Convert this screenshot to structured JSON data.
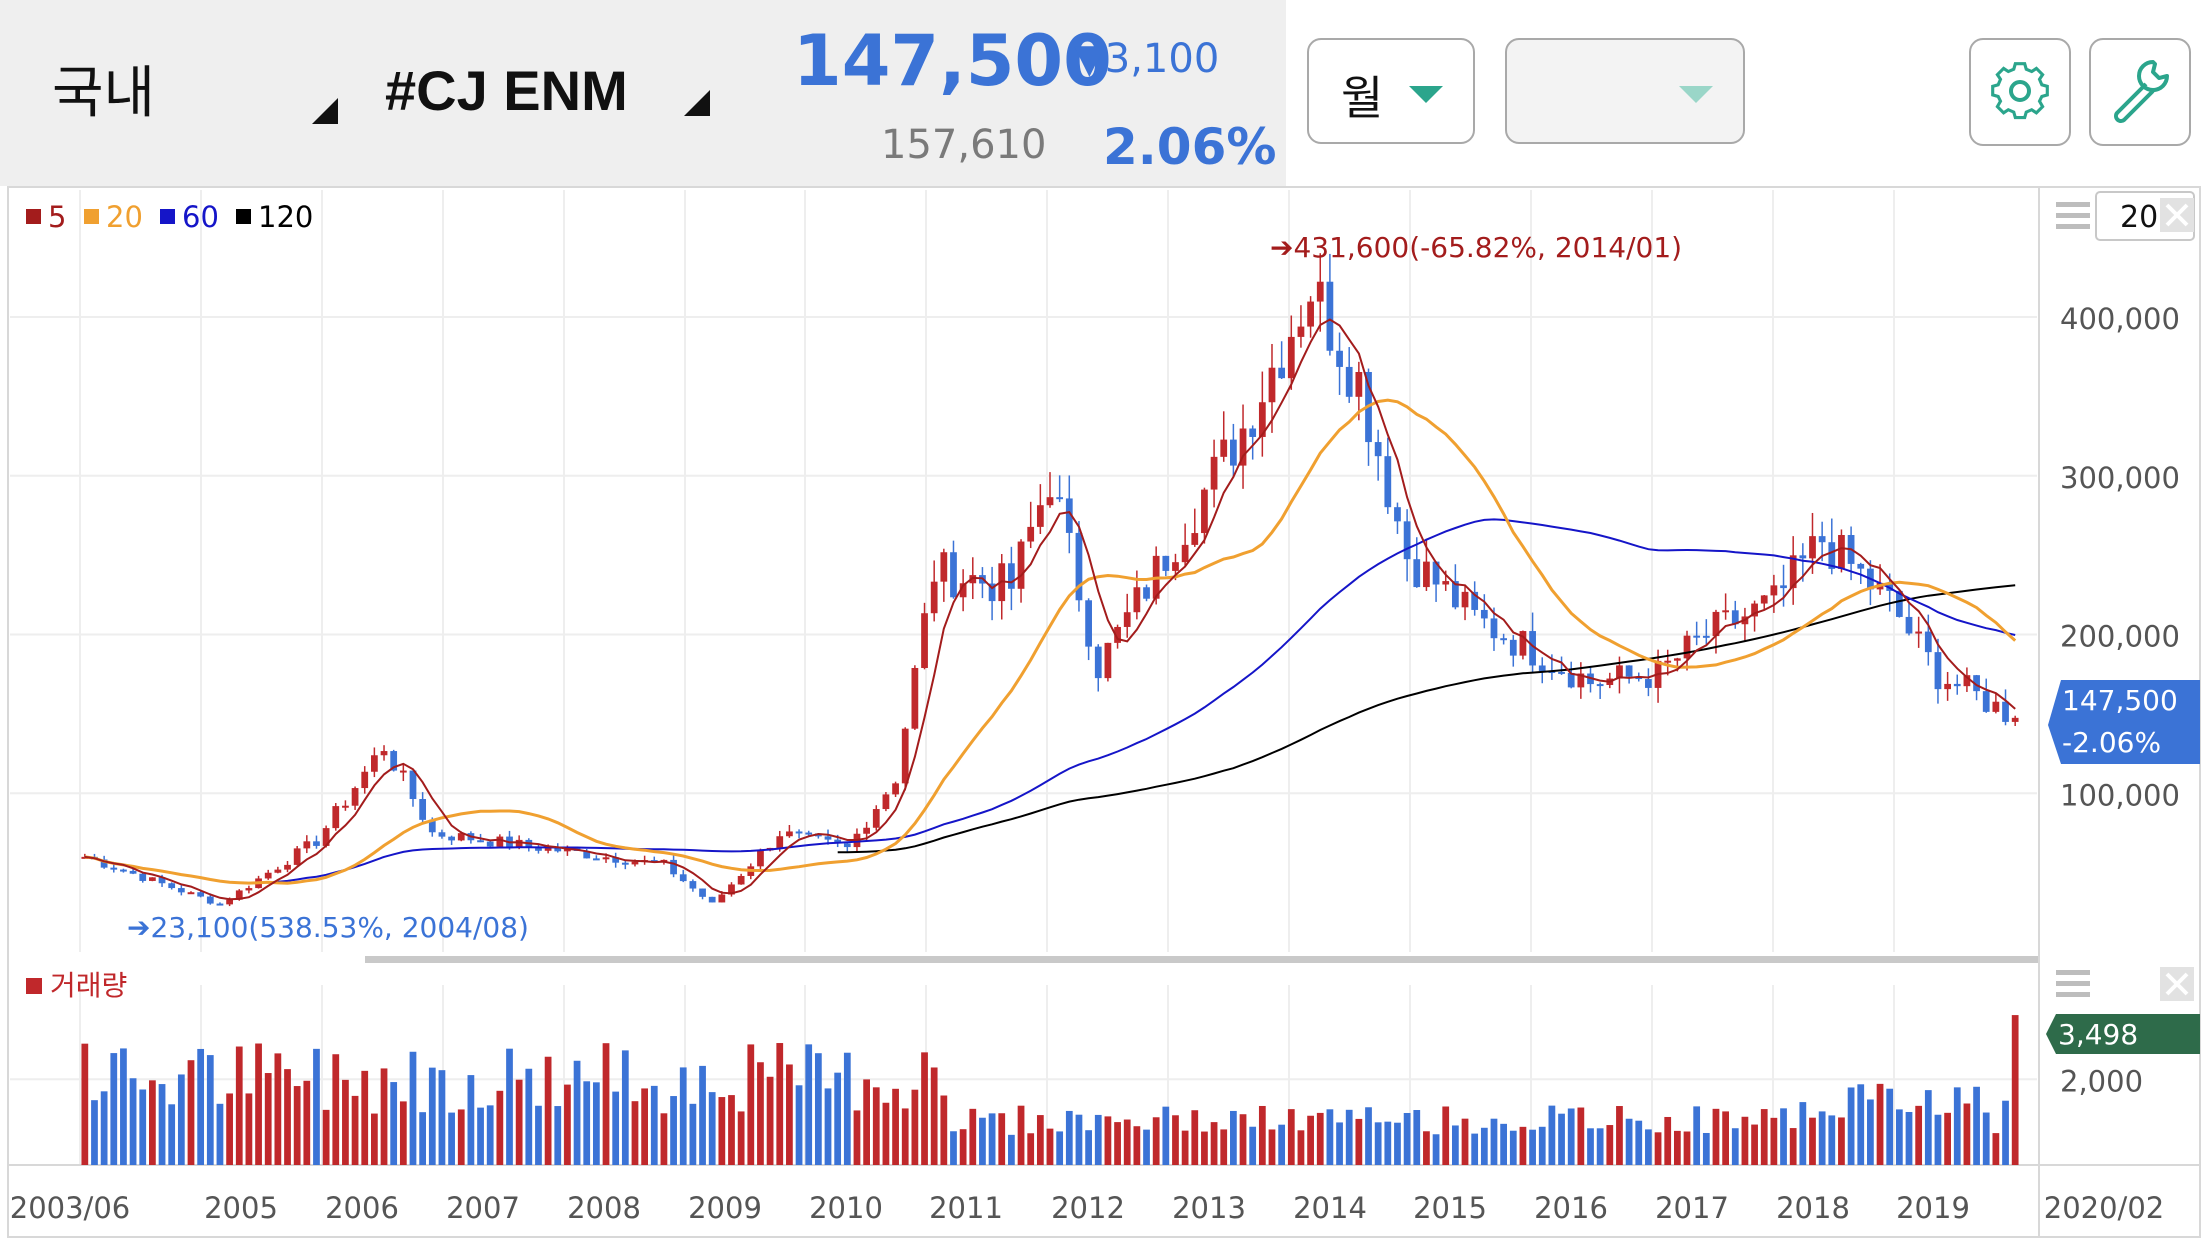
{
  "header": {
    "market": "국내",
    "stock": "#CJ ENM",
    "price": "147,500",
    "change": "▼3,100",
    "prev_value": "157,610",
    "change_pct": "2.06%",
    "period_select": "월",
    "second_select": ""
  },
  "icons": {
    "settings": "gear-icon",
    "tools": "wrench-icon",
    "menu": "hamburger-icon",
    "close": "close-icon"
  },
  "colors": {
    "up": "#c0282b",
    "down": "#3b73d6",
    "ma5": "#a31c1c",
    "ma20": "#f0a030",
    "ma60": "#1515c8",
    "ma120": "#000000",
    "current_price_bg": "#3b73d6",
    "volume_badge_bg": "#2e6b4a"
  },
  "chart_data": {
    "type": "candlestick",
    "interval": "monthly",
    "legend": [
      {
        "label": "5",
        "color": "#a31c1c"
      },
      {
        "label": "20",
        "color": "#f0a030"
      },
      {
        "label": "60",
        "color": "#1515c8"
      },
      {
        "label": "120",
        "color": "#000000"
      }
    ],
    "x_ticks": [
      "2003/06",
      "2005",
      "2006",
      "2007",
      "2008",
      "2009",
      "2010",
      "2011",
      "2012",
      "2013",
      "2014",
      "2015",
      "2016",
      "2017",
      "2018",
      "2019",
      "2020/02"
    ],
    "y_ticks": [
      "400,000",
      "300,000",
      "200,000",
      "100,000"
    ],
    "ylim": [
      0,
      480000
    ],
    "period_box_text": "201",
    "annotations": {
      "high": "431,600(-65.82%, 2014/01)",
      "low": "23,100(538.53%, 2004/08)"
    },
    "current": {
      "price": "147,500",
      "pct": "-2.06%"
    },
    "key_points": [
      {
        "date": "2003/06",
        "close": 60000
      },
      {
        "date": "2004/08",
        "close": 30000
      },
      {
        "date": "2005/06",
        "close": 70000
      },
      {
        "date": "2006/01",
        "close": 130000
      },
      {
        "date": "2006/06",
        "close": 75000
      },
      {
        "date": "2007/06",
        "close": 65000
      },
      {
        "date": "2008/06",
        "close": 55000
      },
      {
        "date": "2008/11",
        "close": 30000
      },
      {
        "date": "2009/06",
        "close": 75000
      },
      {
        "date": "2010/01",
        "close": 65000
      },
      {
        "date": "2010/06",
        "close": 110000
      },
      {
        "date": "2010/10",
        "close": 240000
      },
      {
        "date": "2011/06",
        "close": 230000
      },
      {
        "date": "2011/10",
        "close": 300000
      },
      {
        "date": "2012/03",
        "close": 180000
      },
      {
        "date": "2012/09",
        "close": 240000
      },
      {
        "date": "2013/06",
        "close": 330000
      },
      {
        "date": "2014/01",
        "close": 420000
      },
      {
        "date": "2014/06",
        "close": 360000
      },
      {
        "date": "2014/11",
        "close": 250000
      },
      {
        "date": "2015/06",
        "close": 210000
      },
      {
        "date": "2016/06",
        "close": 170000
      },
      {
        "date": "2017/01",
        "close": 175000
      },
      {
        "date": "2017/06",
        "close": 200000
      },
      {
        "date": "2018/01",
        "close": 220000
      },
      {
        "date": "2018/06",
        "close": 260000
      },
      {
        "date": "2019/01",
        "close": 220000
      },
      {
        "date": "2019/06",
        "close": 175000
      },
      {
        "date": "2020/02",
        "close": 147500
      }
    ],
    "volume": {
      "label": "거래량",
      "y_ticks": [
        "2,000"
      ],
      "last": "3,498",
      "ylim": [
        0,
        4200
      ]
    }
  }
}
